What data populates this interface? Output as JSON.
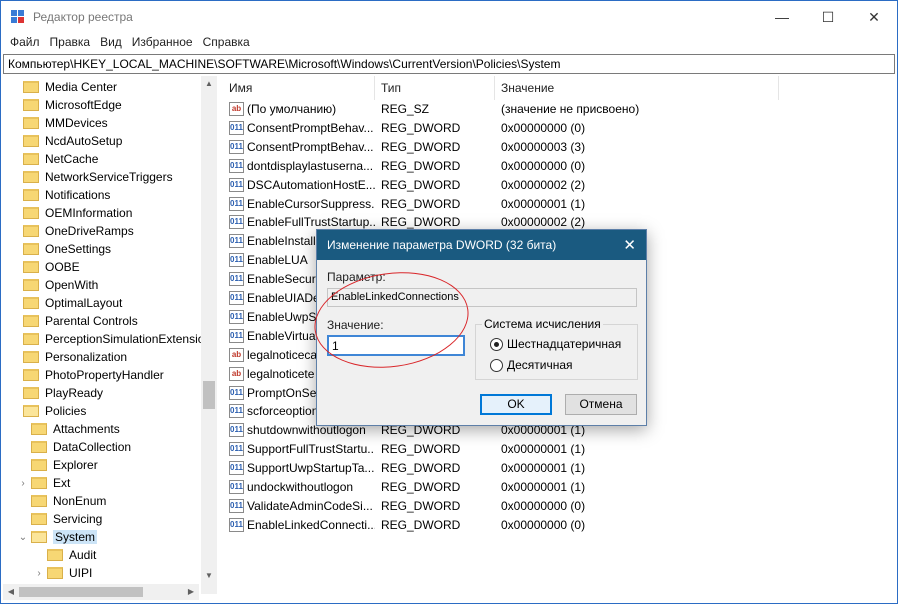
{
  "window": {
    "title": "Редактор реестра",
    "minimize": "—",
    "maximize": "☐",
    "close": "✕"
  },
  "menu": [
    "Файл",
    "Правка",
    "Вид",
    "Избранное",
    "Справка"
  ],
  "address": "Компьютер\\HKEY_LOCAL_MACHINE\\SOFTWARE\\Microsoft\\Windows\\CurrentVersion\\Policies\\System",
  "tree": [
    {
      "label": "Media Center",
      "level": 0,
      "chev": ""
    },
    {
      "label": "MicrosoftEdge",
      "level": 0,
      "chev": ""
    },
    {
      "label": "MMDevices",
      "level": 0,
      "chev": ""
    },
    {
      "label": "NcdAutoSetup",
      "level": 0,
      "chev": ""
    },
    {
      "label": "NetCache",
      "level": 0,
      "chev": ""
    },
    {
      "label": "NetworkServiceTriggers",
      "level": 0,
      "chev": ""
    },
    {
      "label": "Notifications",
      "level": 0,
      "chev": ""
    },
    {
      "label": "OEMInformation",
      "level": 0,
      "chev": ""
    },
    {
      "label": "OneDriveRamps",
      "level": 0,
      "chev": ""
    },
    {
      "label": "OneSettings",
      "level": 0,
      "chev": ""
    },
    {
      "label": "OOBE",
      "level": 0,
      "chev": ""
    },
    {
      "label": "OpenWith",
      "level": 0,
      "chev": ""
    },
    {
      "label": "OptimalLayout",
      "level": 0,
      "chev": ""
    },
    {
      "label": "Parental Controls",
      "level": 0,
      "chev": ""
    },
    {
      "label": "PerceptionSimulationExtensions",
      "level": 0,
      "chev": ""
    },
    {
      "label": "Personalization",
      "level": 0,
      "chev": ""
    },
    {
      "label": "PhotoPropertyHandler",
      "level": 0,
      "chev": ""
    },
    {
      "label": "PlayReady",
      "level": 0,
      "chev": ""
    },
    {
      "label": "Policies",
      "level": 0,
      "chev": "",
      "open": true
    },
    {
      "label": "Attachments",
      "level": 1,
      "chev": ""
    },
    {
      "label": "DataCollection",
      "level": 1,
      "chev": ""
    },
    {
      "label": "Explorer",
      "level": 1,
      "chev": ""
    },
    {
      "label": "Ext",
      "level": 1,
      "chev": "›"
    },
    {
      "label": "NonEnum",
      "level": 1,
      "chev": ""
    },
    {
      "label": "Servicing",
      "level": 1,
      "chev": ""
    },
    {
      "label": "System",
      "level": 1,
      "chev": "⌄",
      "selected": true,
      "open": true
    },
    {
      "label": "Audit",
      "level": 2,
      "chev": ""
    },
    {
      "label": "UIPI",
      "level": 2,
      "chev": "›"
    }
  ],
  "columns": {
    "name": "Имя",
    "type": "Тип",
    "value": "Значение"
  },
  "rows": [
    {
      "icon": "ab",
      "name": "(По умолчанию)",
      "type": "REG_SZ",
      "value": "(значение не присвоено)"
    },
    {
      "icon": "dw",
      "name": "ConsentPromptBehav...",
      "type": "REG_DWORD",
      "value": "0x00000000 (0)"
    },
    {
      "icon": "dw",
      "name": "ConsentPromptBehav...",
      "type": "REG_DWORD",
      "value": "0x00000003 (3)"
    },
    {
      "icon": "dw",
      "name": "dontdisplaylastuserna...",
      "type": "REG_DWORD",
      "value": "0x00000000 (0)"
    },
    {
      "icon": "dw",
      "name": "DSCAutomationHostE...",
      "type": "REG_DWORD",
      "value": "0x00000002 (2)"
    },
    {
      "icon": "dw",
      "name": "EnableCursorSuppress...",
      "type": "REG_DWORD",
      "value": "0x00000001 (1)"
    },
    {
      "icon": "dw",
      "name": "EnableFullTrustStartup...",
      "type": "REG_DWORD",
      "value": "0x00000002 (2)"
    },
    {
      "icon": "dw",
      "name": "EnableInstalle",
      "type": "",
      "value": ""
    },
    {
      "icon": "dw",
      "name": "EnableLUA",
      "type": "",
      "value": ""
    },
    {
      "icon": "dw",
      "name": "EnableSecure",
      "type": "",
      "value": ""
    },
    {
      "icon": "dw",
      "name": "EnableUIADe",
      "type": "",
      "value": ""
    },
    {
      "icon": "dw",
      "name": "EnableUwpSt",
      "type": "",
      "value": ""
    },
    {
      "icon": "dw",
      "name": "EnableVirtual",
      "type": "",
      "value": ""
    },
    {
      "icon": "ab",
      "name": "legalnoticeca",
      "type": "",
      "value": ""
    },
    {
      "icon": "ab",
      "name": "legalnoticete",
      "type": "",
      "value": ""
    },
    {
      "icon": "dw",
      "name": "PromptOnSe",
      "type": "",
      "value": ""
    },
    {
      "icon": "dw",
      "name": "scforceoption",
      "type": "",
      "value": ""
    },
    {
      "icon": "dw",
      "name": "shutdownwithoutlogon",
      "type": "REG_DWORD",
      "value": "0x00000001 (1)"
    },
    {
      "icon": "dw",
      "name": "SupportFullTrustStartu...",
      "type": "REG_DWORD",
      "value": "0x00000001 (1)"
    },
    {
      "icon": "dw",
      "name": "SupportUwpStartupTa...",
      "type": "REG_DWORD",
      "value": "0x00000001 (1)"
    },
    {
      "icon": "dw",
      "name": "undockwithoutlogon",
      "type": "REG_DWORD",
      "value": "0x00000001 (1)"
    },
    {
      "icon": "dw",
      "name": "ValidateAdminCodeSi...",
      "type": "REG_DWORD",
      "value": "0x00000000 (0)"
    },
    {
      "icon": "dw",
      "name": "EnableLinkedConnecti...",
      "type": "REG_DWORD",
      "value": "0x00000000 (0)"
    }
  ],
  "dialog": {
    "title": "Изменение параметра DWORD (32 бита)",
    "close": "✕",
    "param_label": "Параметр:",
    "param_value": "EnableLinkedConnections",
    "value_label": "Значение:",
    "value": "1",
    "base_label": "Система исчисления",
    "hex_label": "Шестнадцатеричная",
    "dec_label": "Десятичная",
    "ok": "OK",
    "cancel": "Отмена"
  },
  "colors": {
    "accent": "#0078d7",
    "dialog_title": "#1a5a80",
    "highlight": "#d9262a"
  }
}
